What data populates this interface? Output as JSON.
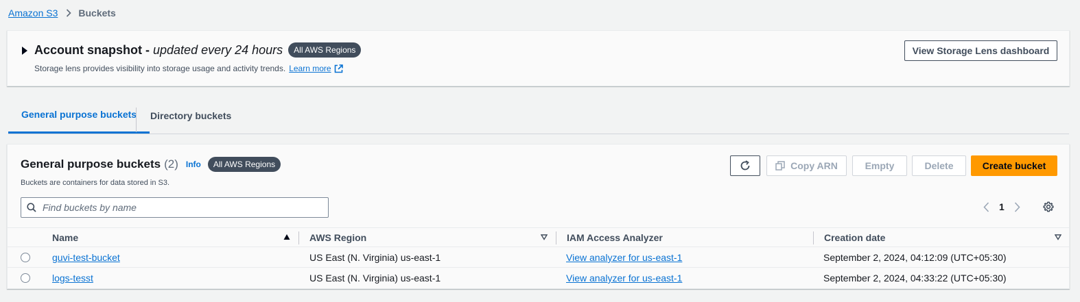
{
  "breadcrumb": {
    "root": "Amazon S3",
    "current": "Buckets"
  },
  "snapshot": {
    "title": "Account snapshot",
    "subtitle": "updated every 24 hours",
    "badge": "All AWS Regions",
    "description": "Storage lens provides visibility into storage usage and activity trends.",
    "learn_more": "Learn more",
    "button": "View Storage Lens dashboard"
  },
  "tabs": [
    {
      "label": "General purpose buckets"
    },
    {
      "label": "Directory buckets"
    }
  ],
  "buckets_panel": {
    "title": "General purpose buckets",
    "count": "(2)",
    "info": "Info",
    "badge": "All AWS Regions",
    "description": "Buckets are containers for data stored in S3.",
    "search_placeholder": "Find buckets by name",
    "buttons": {
      "copy_arn": "Copy ARN",
      "empty": "Empty",
      "delete": "Delete",
      "create": "Create bucket"
    },
    "page": "1",
    "columns": [
      "Name",
      "AWS Region",
      "IAM Access Analyzer",
      "Creation date"
    ],
    "rows": [
      {
        "name": "guvi-test-bucket",
        "region": "US East (N. Virginia) us-east-1",
        "analyzer": "View analyzer for us-east-1",
        "created": "September 2, 2024, 04:12:09 (UTC+05:30)"
      },
      {
        "name": "logs-tesst",
        "region": "US East (N. Virginia) us-east-1",
        "analyzer": "View analyzer for us-east-1",
        "created": "September 2, 2024, 04:33:22 (UTC+05:30)"
      }
    ]
  },
  "colors": {
    "accent": "#0972d3",
    "primary_button": "#ff9900",
    "badge": "#414d5c"
  }
}
